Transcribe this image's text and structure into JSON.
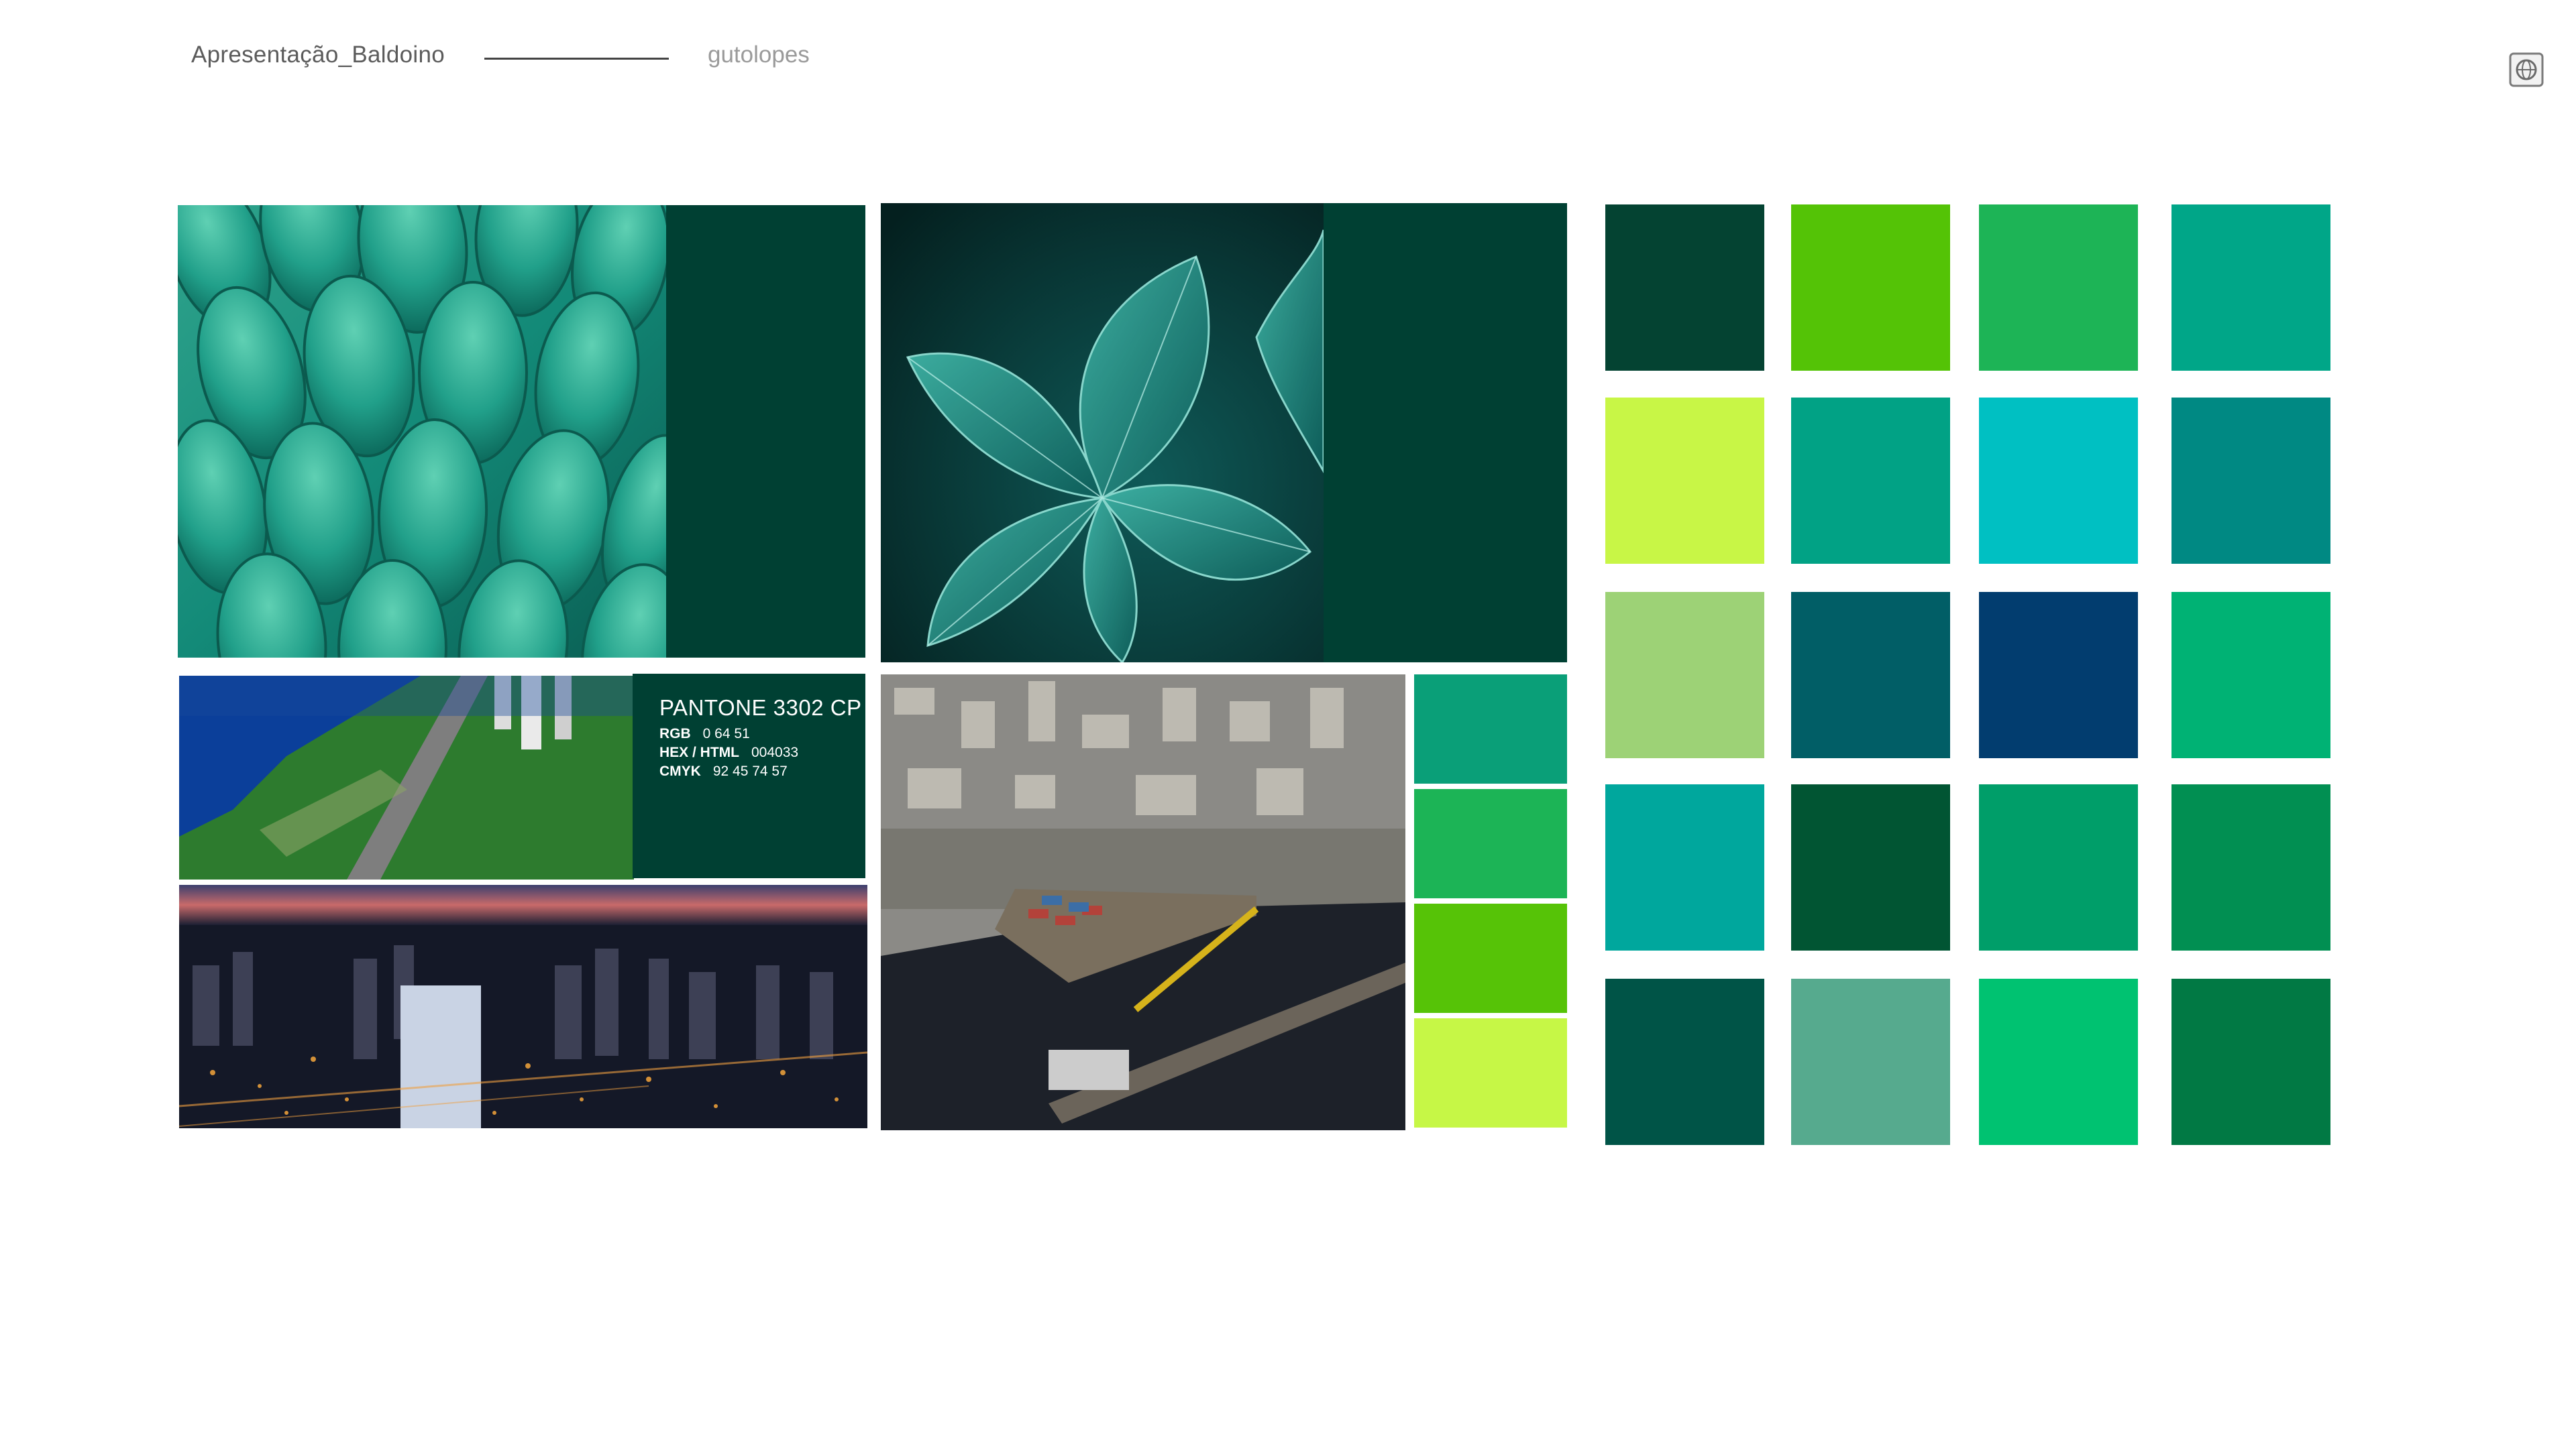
{
  "header": {
    "title": "Apresentação_Baldoino",
    "author": "gutolopes"
  },
  "icons": {
    "corner": "document-globe-icon"
  },
  "pantone": {
    "title": "PANTONE 3302 CP",
    "rgb_label": "RGB",
    "rgb_value": "0  64  51",
    "hex_label": "HEX / HTML",
    "hex_value": "004033",
    "cmyk_label": "CMYK",
    "cmyk_value": "92 45 74 57"
  },
  "colors": {
    "brand_dark": "#004033"
  },
  "strip_swatches": [
    "#0a9f78",
    "#1cb456",
    "#56c307",
    "#c6f746"
  ],
  "palette": [
    [
      "#044332",
      "#54c306",
      "#1db456",
      "#00a688"
    ],
    [
      "#c8f646",
      "#01a285",
      "#00c0c2",
      "#008983"
    ],
    [
      "#9dd276",
      "#015e66",
      "#023d6f",
      "#00b274"
    ],
    [
      "#00a79d",
      "#015533",
      "#009e69",
      "#018f52"
    ],
    [
      "#005447",
      "#56aa8e",
      "#00c271",
      "#017944"
    ]
  ]
}
